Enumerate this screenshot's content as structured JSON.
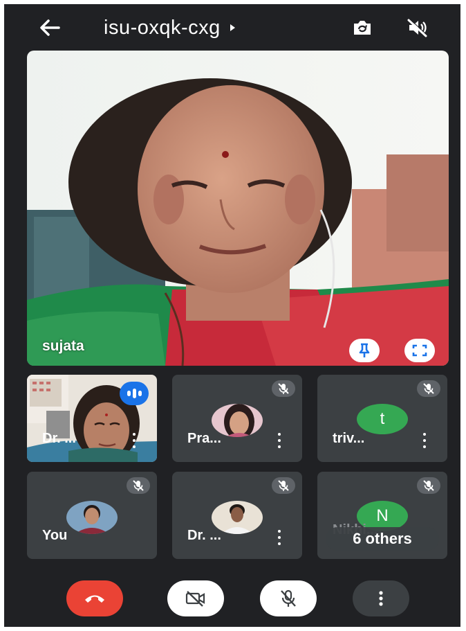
{
  "header": {
    "meeting_code": "isu-oxqk-cxg",
    "back_icon": "arrow-left-icon",
    "switch_camera_icon": "camera-switch-icon",
    "speaker_icon": "volume-off-icon"
  },
  "main_tile": {
    "participant_name": "sujata",
    "pin_icon": "pin-icon",
    "fullscreen_icon": "fullscreen-icon"
  },
  "participants": [
    {
      "name": "Dr. ...",
      "speaking": true
    },
    {
      "name": "Pra...",
      "muted": true
    },
    {
      "name": "triv...",
      "initial": "t",
      "muted": true
    },
    {
      "name": "You",
      "muted": true
    },
    {
      "name": "Dr. ...",
      "muted": true
    },
    {
      "name": "Nikhi...",
      "initial": "N",
      "muted": true,
      "others_label": "6 others"
    }
  ],
  "controls": {
    "end_call_icon": "phone-hangup-icon",
    "camera_icon": "video-off-icon",
    "mic_icon": "mic-off-icon",
    "more_icon": "more-vertical-icon"
  },
  "colors": {
    "background": "#202124",
    "tile": "#3c4043",
    "end_call": "#ea4335",
    "avatar_green": "#35a853",
    "speaking_blue": "#1a73e8"
  }
}
